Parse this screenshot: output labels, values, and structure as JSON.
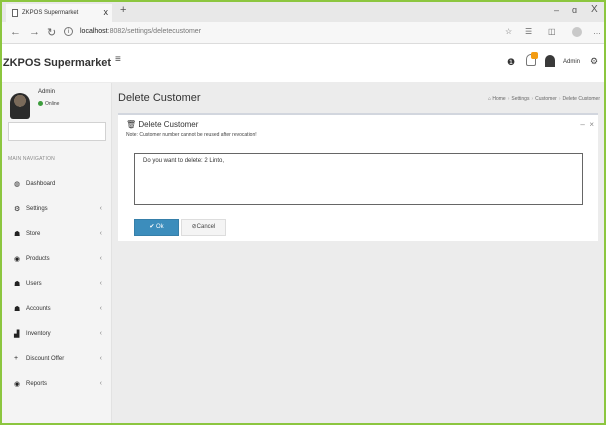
{
  "browser": {
    "tab_title": "ZKPOS Supermarket",
    "tab_close": "x",
    "new_tab": "+",
    "url_host": "localhost",
    "url_path": ":8082/settings/deletecustomer",
    "win_min": "–",
    "win_max": "ɑ",
    "win_close": "X"
  },
  "header": {
    "brand": "ZKPOS Supermarket",
    "user": "Admin"
  },
  "sidebar": {
    "user_name": "Admin",
    "user_status": "Online",
    "nav_header": "MAIN NAVIGATION",
    "items": [
      {
        "label": "Dashboard",
        "icon": "dashboard-icon"
      },
      {
        "label": "Settings",
        "icon": "gear-icon"
      },
      {
        "label": "Store",
        "icon": "store-icon"
      },
      {
        "label": "Products",
        "icon": "products-icon"
      },
      {
        "label": "Users",
        "icon": "users-icon"
      },
      {
        "label": "Accounts",
        "icon": "accounts-icon"
      },
      {
        "label": "Inventory",
        "icon": "inventory-icon"
      },
      {
        "label": "Discount Offer",
        "icon": "plus-icon"
      },
      {
        "label": "Reports",
        "icon": "eye-icon"
      }
    ]
  },
  "main": {
    "page_title": "Delete Customer",
    "breadcrumb": [
      "Home",
      "Settings",
      "Customer",
      "Delete Customer"
    ],
    "box_title": "Delete Customer",
    "note": "Note: Customer number cannot be reused after revocation!",
    "confirm_text": "Do you want to delete: 2 Linto,",
    "ok_label": "Ok",
    "cancel_label": "Cancel"
  },
  "colors": {
    "frame_border": "#8cc63f",
    "primary": "#3c8dbc",
    "online": "#3c9c3c",
    "badge": "#f39c12"
  }
}
